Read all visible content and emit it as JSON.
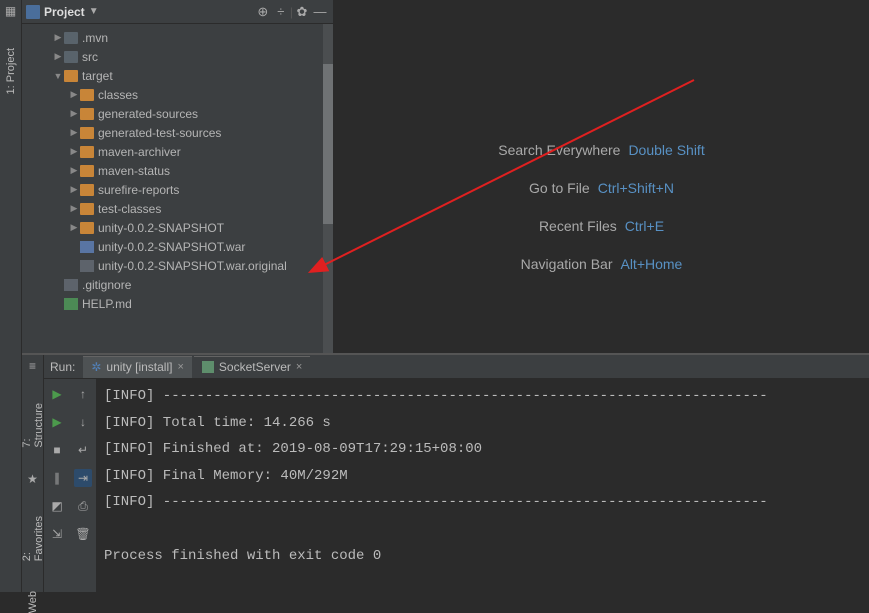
{
  "sidebar_tabs": {
    "project": "1: Project",
    "structure": "7: Structure",
    "favorites": "2: Favorites",
    "web": "Web"
  },
  "project_panel": {
    "title": "Project",
    "nodes": [
      {
        "indent": 1,
        "exp": "▶",
        "ico": "dark",
        "label": ".mvn"
      },
      {
        "indent": 1,
        "exp": "▶",
        "ico": "dark",
        "label": "src"
      },
      {
        "indent": 1,
        "exp": "▼",
        "ico": "orange",
        "label": "target"
      },
      {
        "indent": 2,
        "exp": "▶",
        "ico": "orange",
        "label": "classes"
      },
      {
        "indent": 2,
        "exp": "▶",
        "ico": "orange",
        "label": "generated-sources"
      },
      {
        "indent": 2,
        "exp": "▶",
        "ico": "orange",
        "label": "generated-test-sources"
      },
      {
        "indent": 2,
        "exp": "▶",
        "ico": "orange",
        "label": "maven-archiver"
      },
      {
        "indent": 2,
        "exp": "▶",
        "ico": "orange",
        "label": "maven-status"
      },
      {
        "indent": 2,
        "exp": "▶",
        "ico": "orange",
        "label": "surefire-reports"
      },
      {
        "indent": 2,
        "exp": "▶",
        "ico": "orange",
        "label": "test-classes"
      },
      {
        "indent": 2,
        "exp": "▶",
        "ico": "orange",
        "label": "unity-0.0.2-SNAPSHOT"
      },
      {
        "indent": 2,
        "exp": "",
        "ico": "war",
        "label": "unity-0.0.2-SNAPSHOT.war"
      },
      {
        "indent": 2,
        "exp": "",
        "ico": "plain",
        "label": "unity-0.0.2-SNAPSHOT.war.original"
      },
      {
        "indent": 1,
        "exp": "",
        "ico": "plain",
        "label": ".gitignore"
      },
      {
        "indent": 1,
        "exp": "",
        "ico": "green",
        "label": "HELP.md"
      }
    ]
  },
  "welcome": [
    {
      "label": "Search Everywhere",
      "shortcut": "Double Shift"
    },
    {
      "label": "Go to File",
      "shortcut": "Ctrl+Shift+N"
    },
    {
      "label": "Recent Files",
      "shortcut": "Ctrl+E"
    },
    {
      "label": "Navigation Bar",
      "shortcut": "Alt+Home"
    }
  ],
  "run": {
    "label": "Run:",
    "tabs": [
      {
        "icon": "gear",
        "label": "unity [install]"
      },
      {
        "icon": "srv",
        "label": "SocketServer"
      }
    ],
    "console_lines": [
      "[INFO] ------------------------------------------------------------------------",
      "[INFO] Total time: 14.266 s",
      "[INFO] Finished at: 2019-08-09T17:29:15+08:00",
      "[INFO] Final Memory: 40M/292M",
      "[INFO] ------------------------------------------------------------------------",
      "",
      "Process finished with exit code 0"
    ]
  }
}
